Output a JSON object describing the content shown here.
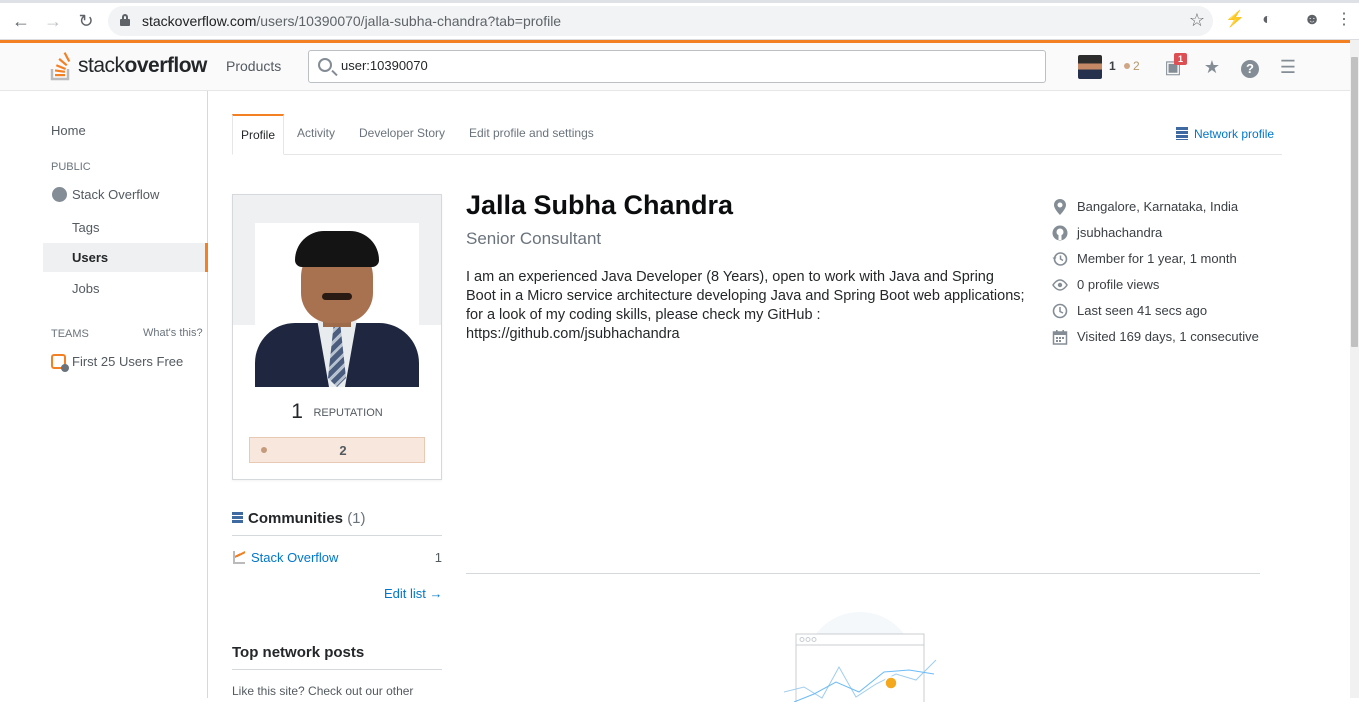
{
  "browser": {
    "url_domain": "stackoverflow.com",
    "url_path": "/users/10390070/jalla-subha-chandra?tab=profile"
  },
  "topbar": {
    "logo_light": "stack",
    "logo_bold": "overflow",
    "products": "Products",
    "search_value": "user:10390070",
    "reputation": "1",
    "bronze_count": "2",
    "inbox_count": "1"
  },
  "leftnav": {
    "home": "Home",
    "public_header": "PUBLIC",
    "stack_overflow": "Stack Overflow",
    "tags": "Tags",
    "users": "Users",
    "jobs": "Jobs",
    "teams_header": "TEAMS",
    "whats_this": "What's this?",
    "teams_free": "First 25 Users Free"
  },
  "tabs": [
    {
      "label": "Profile",
      "active": true
    },
    {
      "label": "Activity",
      "active": false
    },
    {
      "label": "Developer Story",
      "active": false
    },
    {
      "label": "Edit profile and settings",
      "active": false
    }
  ],
  "network_profile": "Network profile",
  "profile": {
    "reputation_value": "1",
    "reputation_label": "REPUTATION",
    "bronze_badges": "2",
    "name": "Jalla Subha Chandra",
    "title": "Senior Consultant",
    "bio": "I am an experienced Java Developer (8 Years), open to work with Java and Spring Boot in a Micro service architecture developing Java and Spring Boot web applications; for a look of my coding skills, please check my GitHub : https://github.com/jsubhachandra"
  },
  "meta": [
    {
      "icon": "location-pin-icon",
      "text": "Bangalore, Karnataka, India"
    },
    {
      "icon": "github-icon",
      "text": "jsubhachandra"
    },
    {
      "icon": "history-icon",
      "text": "Member for 1 year, 1 month"
    },
    {
      "icon": "eye-icon",
      "text": "0 profile views"
    },
    {
      "icon": "clock-icon",
      "text": "Last seen 41 secs ago"
    },
    {
      "icon": "calendar-icon",
      "text": "Visited 169 days, 1 consecutive"
    }
  ],
  "communities": {
    "title": "Communities",
    "count": "(1)",
    "items": [
      {
        "name": "Stack Overflow",
        "count": "1"
      }
    ],
    "edit_list": "Edit list →"
  },
  "top_network_posts": {
    "title": "Top network posts",
    "text": "Like this site? Check out our other"
  },
  "colors": {
    "accent": "#f48024",
    "link": "#0077cc",
    "bronze": "#d1a684",
    "inbox_badge": "#de4f54"
  }
}
